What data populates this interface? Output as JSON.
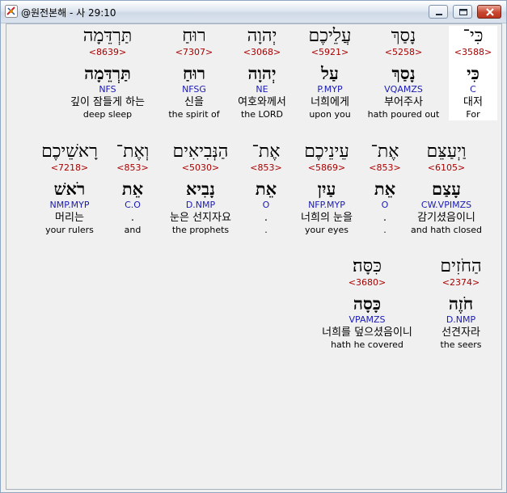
{
  "window": {
    "title": "@원전본해 - 사 29:10",
    "icons": {
      "app": "app-icon",
      "minimize": "minimize-icon",
      "maximize": "maximize-icon",
      "close": "close-icon"
    }
  },
  "rows": [
    [
      {
        "heb": "כִּי־",
        "strong": "<3588>",
        "lex": "כִּי",
        "parse": "C",
        "kor": "대저",
        "eng": "For"
      },
      {
        "heb": "נָסַךְ",
        "strong": "<5258>",
        "lex": "נָסַךְ",
        "parse": "VQAMZS",
        "kor": "부어주사",
        "eng": "hath poured out"
      },
      {
        "heb": "עֲלֵיכֶם",
        "strong": "<5921>",
        "lex": "עַל",
        "parse": "P.MYP",
        "kor": "너희에게",
        "eng": "upon you"
      },
      {
        "heb": "יְהוָה",
        "strong": "<3068>",
        "lex": "יְהוָה",
        "parse": "NE",
        "kor": "여호와께서",
        "eng": "the LORD"
      },
      {
        "heb": "רוּחַ",
        "strong": "<7307>",
        "lex": "רוּחַ",
        "parse": "NFSG",
        "kor": "신을",
        "eng": "the spirit of"
      },
      {
        "heb": "תַּרְדֵּמָה",
        "strong": "<8639>",
        "lex": "תַּרְדֵּמָה",
        "parse": "NFS",
        "kor": "깊이 잠들게 하는",
        "eng": "deep sleep"
      }
    ],
    [
      {
        "heb": "וַיְעַצֵּם",
        "strong": "<6105>",
        "lex": "עָצַם",
        "parse": "CW.VPIMZS",
        "kor": "감기셨음이니",
        "eng": "and hath closed"
      },
      {
        "heb": "אֶת־",
        "strong": "<853>",
        "lex": "אֵת",
        "parse": "O",
        "kor": ".",
        "eng": "."
      },
      {
        "heb": "עֵינֵיכֶם",
        "strong": "<5869>",
        "lex": "עַיִן",
        "parse": "NFP.MYP",
        "kor": "너희의 눈을",
        "eng": "your eyes"
      },
      {
        "heb": "אֶת־",
        "strong": "<853>",
        "lex": "אֵת",
        "parse": "O",
        "kor": ".",
        "eng": "."
      },
      {
        "heb": "הַנְּבִיאִים",
        "strong": "<5030>",
        "lex": "נָבִיא",
        "parse": "D.NMP",
        "kor": "눈은 선지자요",
        "eng": "the prophets"
      },
      {
        "heb": "וְאֶת־",
        "strong": "<853>",
        "lex": "אֵת",
        "parse": "C.O",
        "kor": ".",
        "eng": "and"
      },
      {
        "heb": "רָאשֵׁיכֶם",
        "strong": "<7218>",
        "lex": "רֹאשׁ",
        "parse": "NMP.MYP",
        "kor": "머리는",
        "eng": "your rulers"
      }
    ],
    [
      {
        "heb": "הַחֹזִים",
        "strong": "<2374>",
        "lex": "חֹזֶה",
        "parse": "D.NMP",
        "kor": "선견자라",
        "eng": "the seers"
      },
      {
        "heb": "כִּסָּה׃",
        "strong": "<3680>",
        "lex": "כָּסָה",
        "parse": "VPAMZS",
        "kor": "너희를 덮으셨음이니",
        "eng": "hath he covered"
      }
    ]
  ]
}
